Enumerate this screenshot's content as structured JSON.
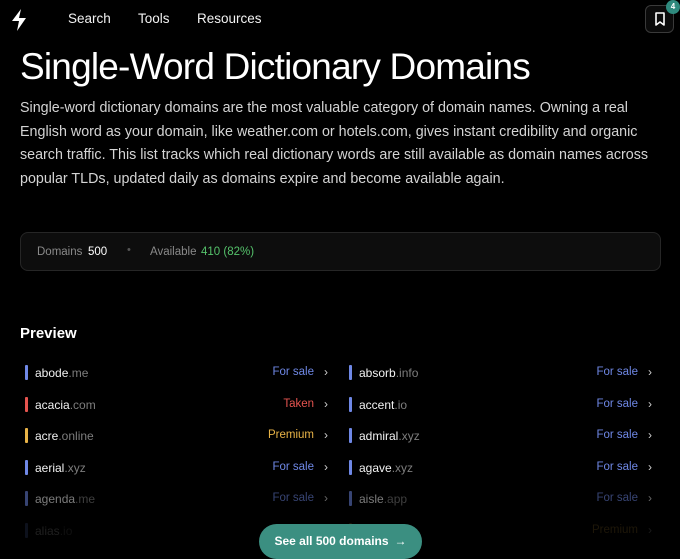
{
  "nav": {
    "links": [
      "Search",
      "Tools",
      "Resources"
    ],
    "bookmark_count": "4",
    "accent": "#2f8a7e"
  },
  "page": {
    "title": "Single-Word Dictionary Domains",
    "intro": "Single-word dictionary domains are the most valuable category of domain names. Owning a real English word as your domain, like weather.com or hotels.com, gives instant credibility and organic search traffic. This list tracks which real dictionary words are still available as domain names across popular TLDs, updated daily as domains expire and become available again."
  },
  "stats": {
    "domains_label": "Domains",
    "domains_value": "500",
    "available_label": "Available",
    "available_value": "410 (82%)"
  },
  "preview": {
    "heading": "Preview",
    "left": [
      {
        "word": "abode",
        "tld": ".me",
        "status": "For sale",
        "color": "#6f88e6"
      },
      {
        "word": "acacia",
        "tld": ".com",
        "status": "Taken",
        "color": "#e5544f"
      },
      {
        "word": "acre",
        "tld": ".online",
        "status": "Premium",
        "color": "#e8b347"
      },
      {
        "word": "aerial",
        "tld": ".xyz",
        "status": "For sale",
        "color": "#6f88e6"
      },
      {
        "word": "agenda",
        "tld": ".me",
        "status": "For sale",
        "color": "#6f88e6"
      },
      {
        "word": "alias",
        "tld": ".io",
        "status": "",
        "color": "#6f88e6"
      }
    ],
    "right": [
      {
        "word": "absorb",
        "tld": ".info",
        "status": "For sale",
        "color": "#6f88e6"
      },
      {
        "word": "accent",
        "tld": ".io",
        "status": "For sale",
        "color": "#6f88e6"
      },
      {
        "word": "admiral",
        "tld": ".xyz",
        "status": "For sale",
        "color": "#6f88e6"
      },
      {
        "word": "agave",
        "tld": ".xyz",
        "status": "For sale",
        "color": "#6f88e6"
      },
      {
        "word": "aisle",
        "tld": ".app",
        "status": "For sale",
        "color": "#6f88e6"
      },
      {
        "word": "",
        "tld": "",
        "status": "Premium",
        "color": "#e8b347"
      }
    ]
  },
  "cta": {
    "label": "See all 500 domains"
  }
}
